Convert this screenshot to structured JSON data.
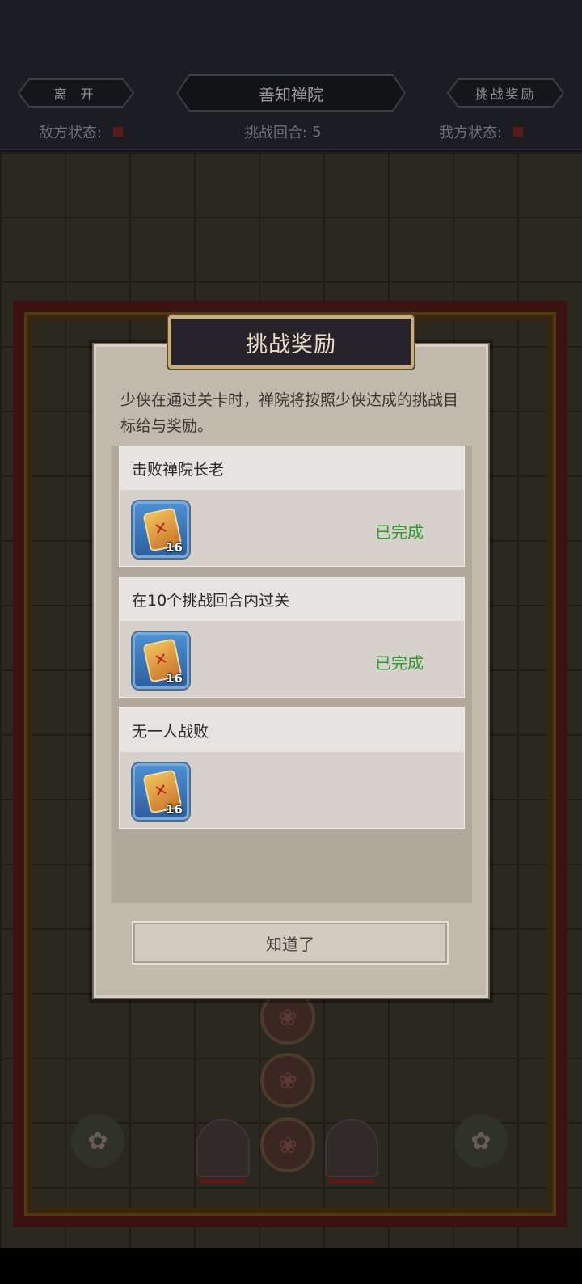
{
  "header": {
    "leave_label": "离 开",
    "stage_name": "善知禅院",
    "rewards_label": "挑战奖励",
    "enemy_status_label": "敌方状态:",
    "round_label": "挑战回合:",
    "round_value": "5",
    "ally_status_label": "我方状态:"
  },
  "modal": {
    "title": "挑战奖励",
    "description": "少侠在通过关卡时，禅院将按照少侠达成的挑战目标给与奖励。",
    "tasks": [
      {
        "title": "击败禅院长老",
        "reward_count": "16",
        "status": "已完成"
      },
      {
        "title": "在10个挑战回合内过关",
        "reward_count": "16",
        "status": "已完成"
      },
      {
        "title": "无一人战败",
        "reward_count": "16",
        "status": ""
      }
    ],
    "ok_label": "知道了"
  },
  "colors": {
    "completed_text": "#2f9a2c",
    "modal_bg": "#c2b9ad",
    "title_bg": "#26232b",
    "frame_red": "#3a1210"
  }
}
